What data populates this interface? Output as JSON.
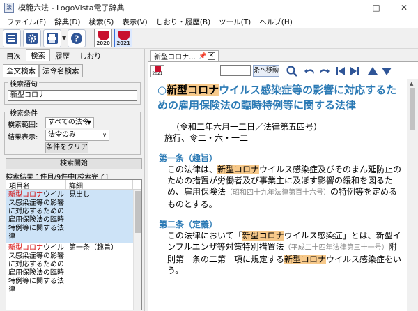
{
  "window": {
    "title": "模範六法 - LogoVista電子辞典"
  },
  "menu": [
    "ファイル(F)",
    "辞典(D)",
    "検索(S)",
    "表示(V)",
    "しおり・履歴(B)",
    "ツール(T)",
    "ヘルプ(H)"
  ],
  "toolbar": {
    "dict1_year": "2020",
    "dict2_year": "2021"
  },
  "left_tabs": [
    "目次",
    "検索",
    "履歴",
    "しおり"
  ],
  "search_tabs": [
    "全文検索",
    "法令名検索"
  ],
  "search": {
    "term_label": "検索語句",
    "term_value": "新型コロナ",
    "cond_label": "検索条件",
    "range_label": "検索範囲:",
    "range_value": "すべての法令",
    "display_label": "結果表示:",
    "display_value": "法令のみ",
    "clear_button": "条件をクリア",
    "start_button": "検索開始"
  },
  "results": {
    "summary": "検索結果 1件目/9件中[検索完了]",
    "col1": "項目名",
    "col2": "詳細",
    "rows": [
      {
        "kw": "新型コロナ",
        "rest": "ウイルス感染症等の影響に対応するための雇用保険法の臨時特例等に関する法律",
        "detail": "見出し"
      },
      {
        "kw": "新型コロナ",
        "rest": "ウイルス感染症等の影響に対応するための雇用保険法の臨時特例等に関する法律",
        "detail": "第一条（趣旨）"
      }
    ]
  },
  "doc_tab": {
    "label": "新型コロナ…"
  },
  "nav": {
    "dict_year": "2021",
    "move_button": "条へ移動"
  },
  "doc": {
    "title_prefix": "○",
    "title_kw": "新型コロナ",
    "title_rest": "ウイルス感染症等の影響に対応するための雇用保険法の臨時特例等に関する法律",
    "sub1": "（令和二年六月一二日／法律第五四号）",
    "sub2": "施行、令二・六・一二",
    "art1_head": "第一条（趣旨）",
    "art1_a": "この法律は、",
    "art1_kw": "新型コロナ",
    "art1_b": "ウイルス感染症及びそのまん延防止のための措置が労働者及び事業主に及ぼす影響の緩和を図るため、雇用保険法",
    "art1_ref": "（昭和四十九年法律第百十六号）",
    "art1_c": "の特例等を定めるものとする。",
    "art2_head": "第二条（定義）",
    "art2_a": "この法律において「",
    "art2_kw": "新型コロナ",
    "art2_b": "ウイルス感染症」とは、新型インフルエンザ等対策特別措置法",
    "art2_ref": "（平成二十四年法律第三十一号）",
    "art2_c": "附則第一条の二第一項に規定する",
    "art2_kw2": "新型コロナ",
    "art2_d": "ウイルス感染症をいう。"
  }
}
